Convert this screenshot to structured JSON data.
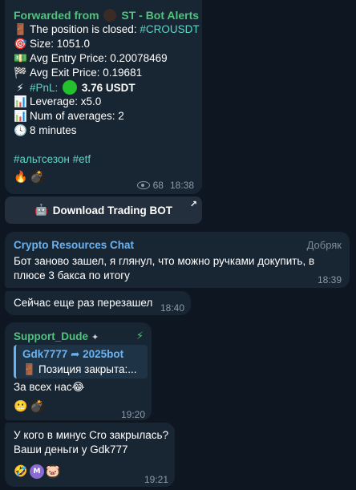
{
  "message1": {
    "forward_prefix": "Forwarded from",
    "forward_channel": "ST - Bot Alerts",
    "lines": [
      {
        "emoji": "🚪",
        "text": "The position is closed: ",
        "highlight": "#CROUSDT"
      },
      {
        "emoji": "🎯",
        "text": "Size: 1051.0"
      },
      {
        "emoji": "💵",
        "text": "Avg Entry Price: 0.20078469"
      },
      {
        "emoji": "🏁",
        "text": "Avg Exit Price: 0.19681"
      },
      {
        "emoji": "⚡",
        "text": "#PnL:",
        "value": "3.76 USDT"
      },
      {
        "emoji": "📊",
        "text": "Leverage: x5.0"
      },
      {
        "emoji": "📊",
        "text": "Num of averages: 2"
      },
      {
        "emoji": "🕓",
        "text": "8 minutes"
      }
    ],
    "hashtags": "#альтсезон #etf",
    "views": "68",
    "time": "18:38",
    "reactions": [
      "🔥",
      "💣"
    ]
  },
  "inline_button": {
    "icon": "robot-icon",
    "label": "Download Trading BOT",
    "arrow": "↗"
  },
  "message2": {
    "sender": "Crypto Resources Chat",
    "role": "Добряк",
    "text": "Бот заново зашел, я глянул, что можно ручками докупить, в плюсе 3 бакса по итогу",
    "time": "18:39"
  },
  "message3": {
    "text": "Сейчас еще раз перезашел",
    "time": "18:40"
  },
  "message4": {
    "sender": "Support_Dude",
    "reply_from": "Gdk7777",
    "reply_to": "2025bot",
    "reply_text": "Позиция закрыта:...",
    "text": "За всех нас😂",
    "reactions": [
      "😬",
      "💣"
    ],
    "time": "19:20"
  },
  "message5": {
    "text": "У кого в минус Cro закрылась? Ваши деньги у Gdk777",
    "reactions": [
      "🤣",
      "M",
      "🐷"
    ],
    "time": "19:21"
  },
  "colors": {
    "background": "#0e1621",
    "bubble": "#182533",
    "accent_green": "#4fc47d",
    "accent_blue": "#6ab3f3",
    "hashtag": "#5fd7c7"
  }
}
